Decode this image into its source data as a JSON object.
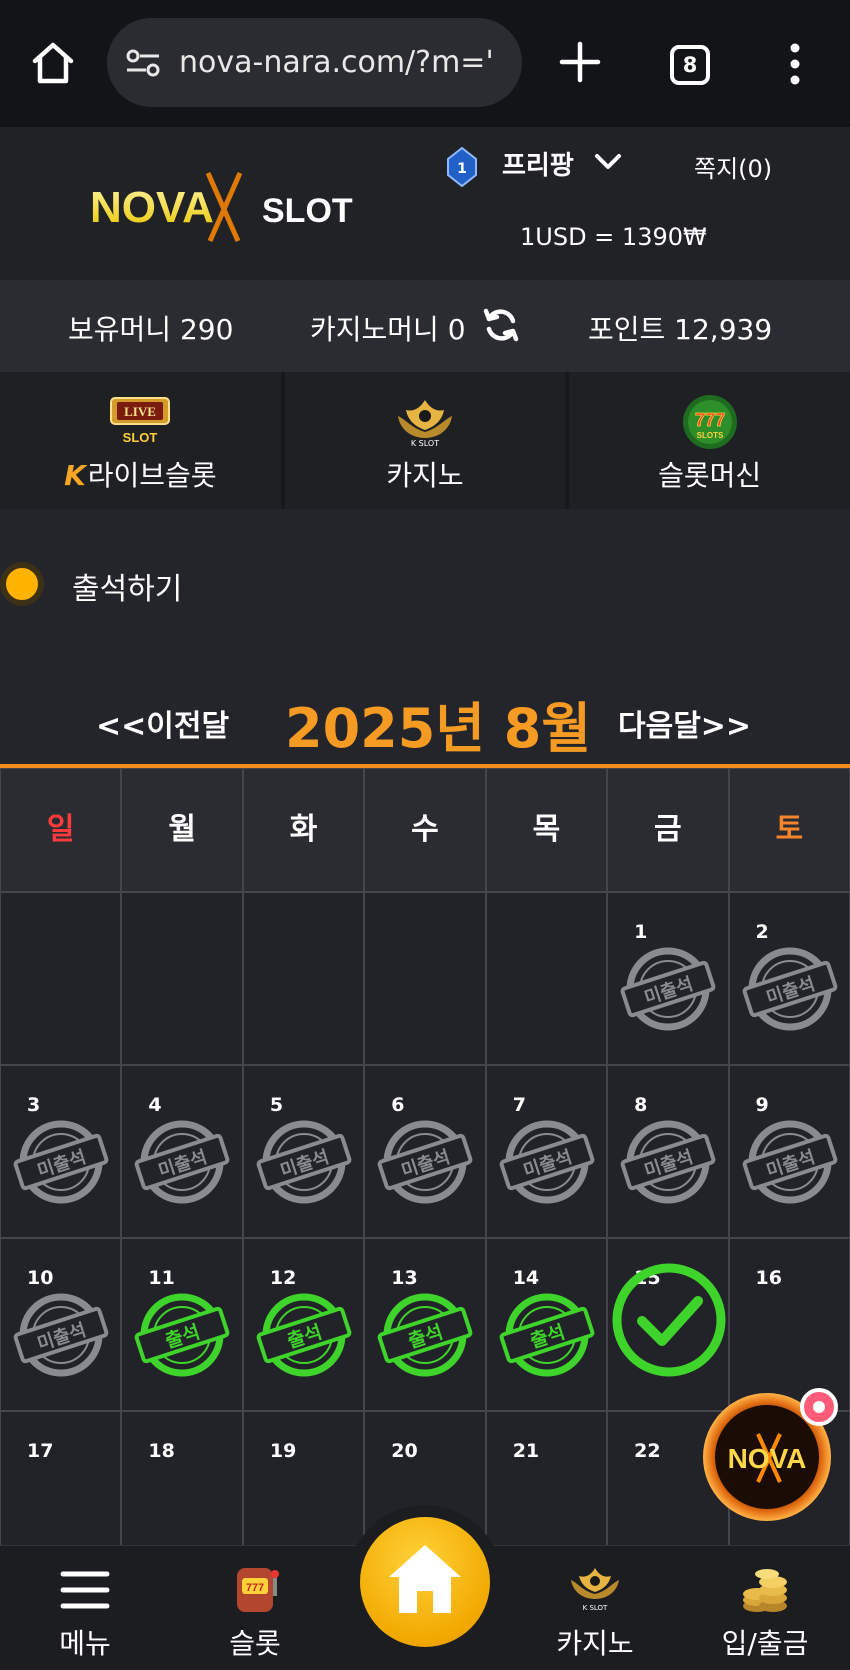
{
  "browser": {
    "url": "nova-nara.com/?m='",
    "tab_count": "8"
  },
  "header": {
    "logo_text_left": "NOVA",
    "logo_text_right": "SLOT",
    "rank_level": "1",
    "nickname": "프리팡",
    "messages": "쪽지(0)",
    "exchange_rate": "1USD = 1390₩"
  },
  "balance": {
    "money": "보유머니 290",
    "casino_money": "카지노머니 0",
    "points": "포인트 12,939"
  },
  "game_tabs": [
    {
      "label": "라이브슬롯",
      "prefix": "K",
      "icon": "live-slot-icon"
    },
    {
      "label": "카지노",
      "icon": "kslot-casino-icon"
    },
    {
      "label": "슬롯머신",
      "icon": "777-slots-icon"
    }
  ],
  "section_title": "출석하기",
  "calendar": {
    "prev_label": "<<이전달",
    "month_label": "2025년 8월",
    "next_label": "다음달>>",
    "weekdays": [
      "일",
      "월",
      "화",
      "수",
      "목",
      "금",
      "토"
    ],
    "weeks": [
      [
        {
          "day": "",
          "status": ""
        },
        {
          "day": "",
          "status": ""
        },
        {
          "day": "",
          "status": ""
        },
        {
          "day": "",
          "status": ""
        },
        {
          "day": "",
          "status": ""
        },
        {
          "day": "1",
          "status": "absent"
        },
        {
          "day": "2",
          "status": "absent"
        }
      ],
      [
        {
          "day": "3",
          "status": "absent"
        },
        {
          "day": "4",
          "status": "absent"
        },
        {
          "day": "5",
          "status": "absent"
        },
        {
          "day": "6",
          "status": "absent"
        },
        {
          "day": "7",
          "status": "absent"
        },
        {
          "day": "8",
          "status": "absent"
        },
        {
          "day": "9",
          "status": "absent"
        }
      ],
      [
        {
          "day": "10",
          "status": "absent"
        },
        {
          "day": "11",
          "status": "present"
        },
        {
          "day": "12",
          "status": "present"
        },
        {
          "day": "13",
          "status": "present"
        },
        {
          "day": "14",
          "status": "present"
        },
        {
          "day": "15",
          "status": "today"
        },
        {
          "day": "16",
          "status": ""
        }
      ],
      [
        {
          "day": "17",
          "status": ""
        },
        {
          "day": "18",
          "status": ""
        },
        {
          "day": "19",
          "status": ""
        },
        {
          "day": "20",
          "status": ""
        },
        {
          "day": "21",
          "status": ""
        },
        {
          "day": "22",
          "status": ""
        },
        {
          "day": "",
          "status": ""
        }
      ]
    ],
    "stamp_absent": "미출석",
    "stamp_present": "출석"
  },
  "bottom_nav": [
    {
      "label": "메뉴",
      "icon": "hamburger-icon"
    },
    {
      "label": "슬롯",
      "icon": "slot-machine-icon"
    },
    {
      "label": "",
      "icon": "home-icon"
    },
    {
      "label": "카지노",
      "icon": "kslot-casino-icon"
    },
    {
      "label": "입/출금",
      "icon": "coins-icon"
    }
  ],
  "colors": {
    "accent_orange": "#f59a23",
    "present_green": "#3fd42b",
    "absent_gray": "#8a8b90",
    "sunday_red": "#ff3b3b",
    "saturday_orange": "#f5842b"
  }
}
